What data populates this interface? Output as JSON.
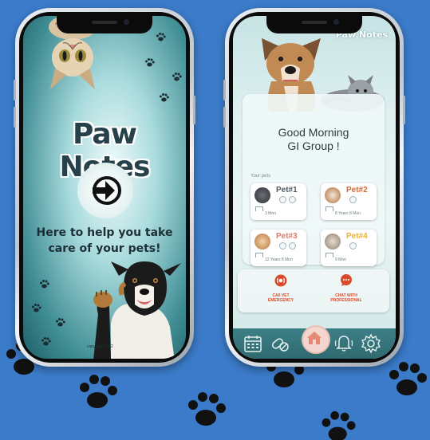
{
  "splash": {
    "app_title": "Paw Notes",
    "tagline": "Here to help you take care of your pets!",
    "copyright": "copyright 2022"
  },
  "home": {
    "brand": "Paw Notes",
    "greeting_line1": "Good Morning",
    "greeting_line2": "GI Group !",
    "section_label": "Your pets",
    "pets": [
      {
        "name": "Pet#1",
        "age": "3 Mon",
        "name_color": "#4d5a63"
      },
      {
        "name": "Pet#2",
        "age": "8 Years 8 Mon",
        "name_color": "#d9662e"
      },
      {
        "name": "Pet#3",
        "age": "12 Years 8 Mon",
        "name_color": "#e07a63"
      },
      {
        "name": "Pet#4",
        "age": "9 Mon",
        "name_color": "#f0b323"
      }
    ],
    "actions": [
      {
        "label_line1": "CAll VET",
        "label_line2": "EMERGENCY",
        "icon": "emergency-icon"
      },
      {
        "label_line1": "CHAT WITH",
        "label_line2": "PROFESSIONAL",
        "icon": "chat-icon"
      }
    ],
    "tabs": [
      "calendar-icon",
      "medicine-icon",
      "home-icon",
      "bell-icon",
      "settings-icon"
    ]
  },
  "colors": {
    "background": "#3b7bc9",
    "accent": "#d94b2b",
    "tabbar": "#3d7f86"
  }
}
